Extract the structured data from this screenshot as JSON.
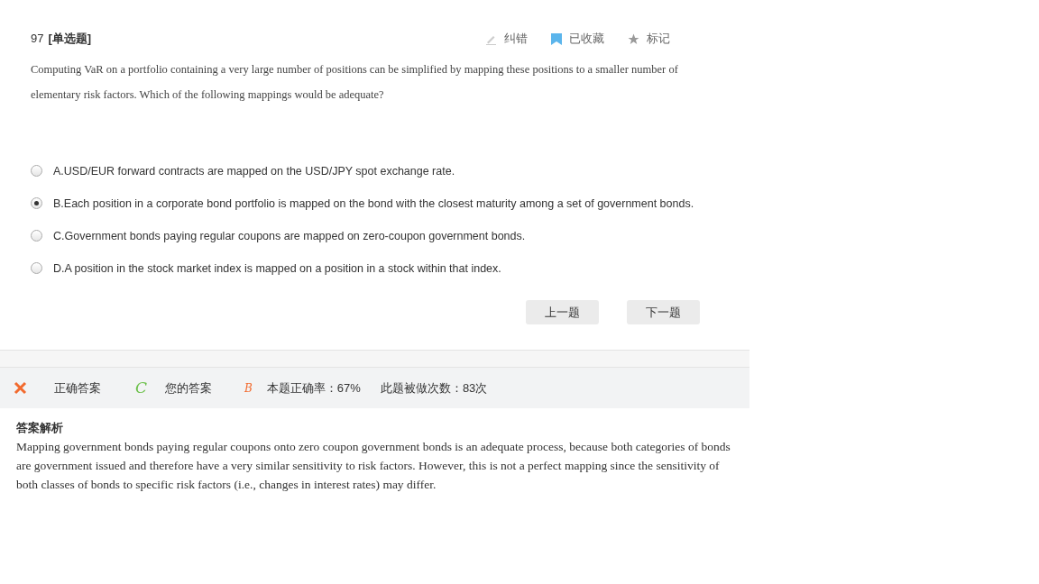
{
  "question": {
    "number": "97",
    "type": "[单选题]",
    "text": "Computing VaR on a portfolio containing a very large number of positions can be simplified by mapping these positions to a smaller number of elementary risk factors. Which of the following mappings would be adequate?"
  },
  "actions": [
    {
      "kind": "edit",
      "label": "纠错"
    },
    {
      "kind": "bookmark",
      "label": "已收藏"
    },
    {
      "kind": "star",
      "label": "标记"
    }
  ],
  "options": [
    {
      "text": "A.USD/EUR forward contracts are mapped on the USD/JPY spot exchange rate.",
      "selected": false
    },
    {
      "text": "B.Each position in a corporate bond portfolio is mapped on the bond with the closest maturity among a set of government bonds.",
      "selected": true
    },
    {
      "text": "C.Government bonds paying regular coupons are mapped on zero-coupon government bonds.",
      "selected": false
    },
    {
      "text": "D.A position in the stock market index is mapped on a position in a stock within that index.",
      "selected": false
    }
  ],
  "buttons": [
    "上一题",
    "下一题"
  ],
  "result": {
    "correct": false,
    "correct_answer_label": "正确答案",
    "correct_answer": "C",
    "your_answer_label": "您的答案",
    "your_answer": "B",
    "rate": "本题正确率：67%",
    "count": "此题被做次数：83次"
  },
  "explanation": {
    "title": "答案解析",
    "text": "Mapping government bonds paying regular coupons onto zero coupon government bonds is an adequate process, because both categories of bonds are government issued and therefore have a very similar sensitivity to risk factors. However, this is not a perfect mapping since the sensitivity of both classes of bonds to specific risk factors (i.e., changes in interest rates) may differ."
  }
}
